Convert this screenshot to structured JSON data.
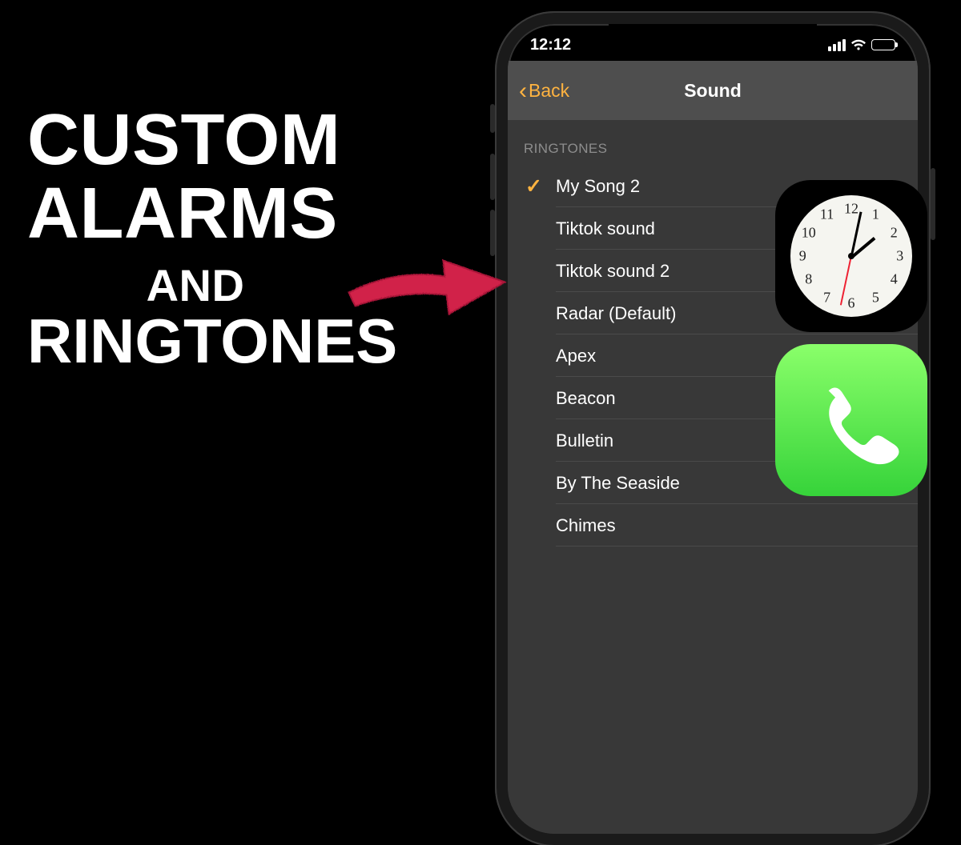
{
  "promo": {
    "line1": "CUSTOM",
    "line2": "ALARMS",
    "and": "AND",
    "line3": "RINGTONES"
  },
  "status": {
    "time": "12:12"
  },
  "nav": {
    "back_label": "Back",
    "title": "Sound"
  },
  "section": {
    "ringtones_header": "RINGTONES"
  },
  "ringtones": [
    {
      "label": "My Song 2",
      "selected": true
    },
    {
      "label": "Tiktok sound",
      "selected": false
    },
    {
      "label": "Tiktok sound 2",
      "selected": false
    },
    {
      "label": "Radar (Default)",
      "selected": false
    },
    {
      "label": "Apex",
      "selected": false
    },
    {
      "label": "Beacon",
      "selected": false
    },
    {
      "label": "Bulletin",
      "selected": false
    },
    {
      "label": "By The Seaside",
      "selected": false
    },
    {
      "label": "Chimes",
      "selected": false
    }
  ],
  "colors": {
    "accent": "#ffb340",
    "phone_icon_top": "#8aff6a",
    "phone_icon_bottom": "#36d33a",
    "arrow": "#d1244a"
  }
}
